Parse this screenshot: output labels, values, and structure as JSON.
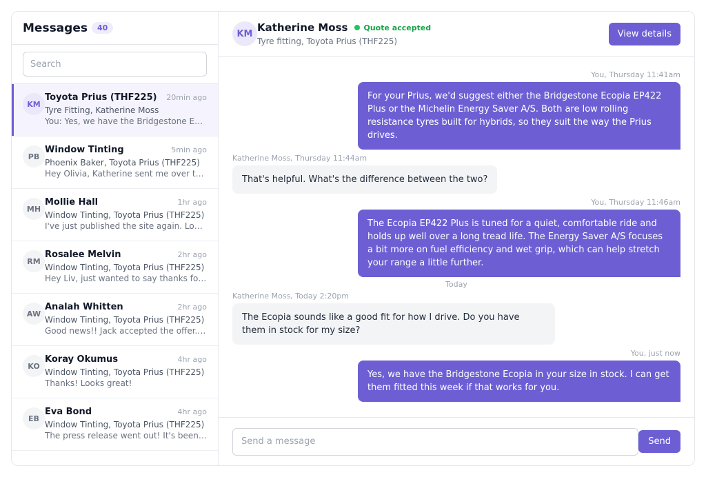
{
  "sidebar": {
    "title": "Messages",
    "count": "40",
    "search_placeholder": "Search",
    "conversations": [
      {
        "initials": "KM",
        "name": "Toyota Prius (THF225)",
        "time": "20min ago",
        "subtitle": "Tyre Fitting, Katherine Moss",
        "preview": "You: Yes, we have the Bridgestone Ecopia in your size in stock.",
        "active": true
      },
      {
        "initials": "PB",
        "name": "Window Tinting",
        "time": "5min ago",
        "subtitle": "Phoenix Baker, Toyota Prius (THF225)",
        "preview": "Hey Olivia, Katherine sent me over the latest details."
      },
      {
        "initials": "MH",
        "name": "Mollie Hall",
        "time": "1hr ago",
        "subtitle": "Window Tinting, Toyota Prius (THF225)",
        "preview": "I've just published the site again. Looks good!"
      },
      {
        "initials": "RM",
        "name": "Rosalee Melvin",
        "time": "2hr ago",
        "subtitle": "Window Tinting, Toyota Prius (THF225)",
        "preview": "Hey Liv, just wanted to say thanks for the help."
      },
      {
        "initials": "AW",
        "name": "Analah Whitten",
        "time": "2hr ago",
        "subtitle": "Window Tinting, Toyota Prius (THF225)",
        "preview": "Good news!! Jack accepted the offer. I've sent it over."
      },
      {
        "initials": "KO",
        "name": "Koray Okumus",
        "time": "4hr ago",
        "subtitle": "Window Tinting, Toyota Prius (THF225)",
        "preview": "Thanks! Looks great!"
      },
      {
        "initials": "EB",
        "name": "Eva Bond",
        "time": "4hr ago",
        "subtitle": "Window Tinting, Toyota Prius (THF225)",
        "preview": "The press release went out! It's been shared widely."
      }
    ]
  },
  "header": {
    "initials": "KM",
    "name": "Katherine Moss",
    "status": "Quote accepted",
    "subtitle": "Tyre fitting, Toyota Prius (THF225)",
    "view_details": "View details"
  },
  "thread": {
    "messages": [
      {
        "meta": "You, Thursday 11:41am",
        "text": "For your Prius, we'd suggest either the Bridgestone Ecopia EP422 Plus or the Michelin Energy Saver A/S. Both are low rolling resistance tyres built for hybrids, so they suit the way the Prius drives."
      },
      {
        "meta": "Katherine Moss, Thursday 11:44am",
        "text": "That's helpful. What's the difference between the two?"
      },
      {
        "meta": "You, Thursday 11:46am",
        "text": "The Ecopia EP422 Plus is tuned for a quiet, comfortable ride and holds up well over a long tread life. The Energy Saver A/S focuses a bit more on fuel efficiency and wet grip, which can help stretch your range a little further."
      },
      {
        "meta": "Katherine Moss, Today 2:20pm",
        "text": "The Ecopia sounds like a good fit for how I drive. Do you have them in stock for my size?"
      },
      {
        "meta": "You, just now",
        "text": "Yes, we have the Bridgestone Ecopia in your size in stock. I can get them fitted this week if that works for you."
      }
    ],
    "divider": "Today"
  },
  "composer": {
    "placeholder": "Send a message",
    "send_label": "Send"
  },
  "colors": {
    "accent": "#6d5fd3",
    "status_green": "#22c55e"
  }
}
